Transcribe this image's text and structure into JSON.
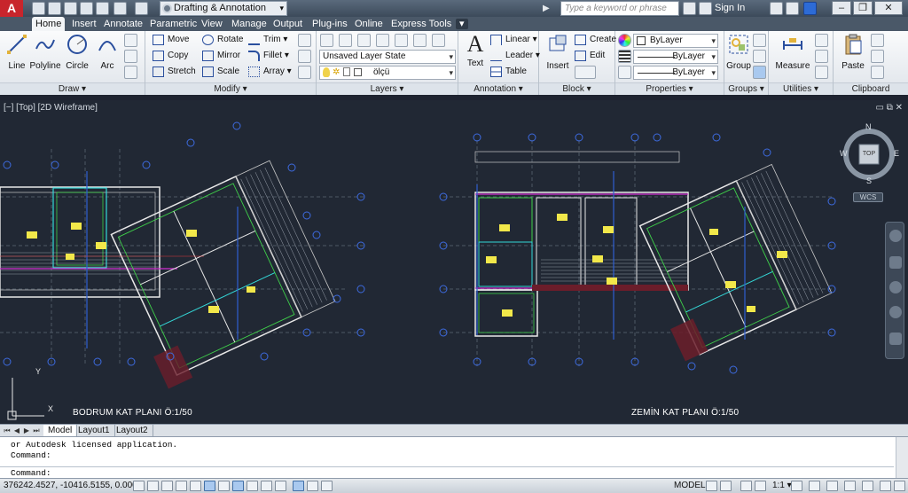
{
  "titlebar": {
    "app_letter": "A",
    "workspace": "Drafting & Annotation",
    "title_text": "",
    "search_placeholder": "Type a keyword or phrase",
    "sign_in": "Sign In"
  },
  "ribbon_tabs": [
    "Home",
    "Insert",
    "Annotate",
    "Parametric",
    "View",
    "Manage",
    "Output",
    "Plug-ins",
    "Online",
    "Express Tools"
  ],
  "active_tab": "Home",
  "panels": {
    "draw": {
      "title": "Draw ▾",
      "line": "Line",
      "polyline": "Polyline",
      "circle": "Circle",
      "arc": "Arc"
    },
    "modify": {
      "title": "Modify ▾",
      "move": "Move",
      "rotate": "Rotate",
      "trim": "Trim ▾",
      "copy": "Copy",
      "mirror": "Mirror",
      "fillet": "Fillet ▾",
      "stretch": "Stretch",
      "scale": "Scale",
      "array": "Array ▾"
    },
    "layers": {
      "title": "Layers ▾",
      "layer_state": "Unsaved Layer State",
      "current_layer": "ölçü"
    },
    "annotation": {
      "title": "Annotation ▾",
      "text": "Text",
      "linear": "Linear ▾",
      "leader": "Leader ▾",
      "table": "Table"
    },
    "block": {
      "title": "Block ▾",
      "insert": "Insert",
      "create": "Create",
      "edit": "Edit"
    },
    "properties": {
      "title": "Properties ▾",
      "color": "ByLayer",
      "linetype": "ByLayer",
      "lineweight": "ByLayer"
    },
    "groups": {
      "title": "Groups ▾",
      "group": "Group"
    },
    "utilities": {
      "title": "Utilities ▾",
      "measure": "Measure"
    },
    "clipboard": {
      "title": "Clipboard",
      "paste": "Paste"
    }
  },
  "viewport": {
    "label": "[−] [Top] [2D Wireframe]",
    "controls": "▭ ⧉ ✕",
    "left_plan_title": "BODRUM KAT PLANI Ö:1/50",
    "right_plan_title": "ZEMİN KAT PLANI Ö:1/50",
    "ucs_y": "Y",
    "ucs_x": "X"
  },
  "viewcube": {
    "north": "N",
    "south": "S",
    "east": "E",
    "west": "W",
    "face": "TOP",
    "wcs": "WCS"
  },
  "layout_tabs": [
    "Model",
    "Layout1",
    "Layout2"
  ],
  "active_layout": "Model",
  "command": {
    "history_1": "or Autodesk licensed application.",
    "history_2": "Command:",
    "prompt": "Command:"
  },
  "statusbar": {
    "coordinates": "376242.4527, -10416.5155, 0.0000",
    "model": "MODEL",
    "scale": "1:1 ▾"
  },
  "colors": {
    "viewport_bg": "#212834",
    "accent_blue": "#2f5fd0",
    "wall_white": "#e8e8e8",
    "grid_marker": "#3d6be0",
    "yellow_block": "#f2e84a",
    "magenta": "#d12fd1",
    "cyan": "#34d8d8",
    "green": "#3fd04a",
    "red": "#e23a3a"
  }
}
